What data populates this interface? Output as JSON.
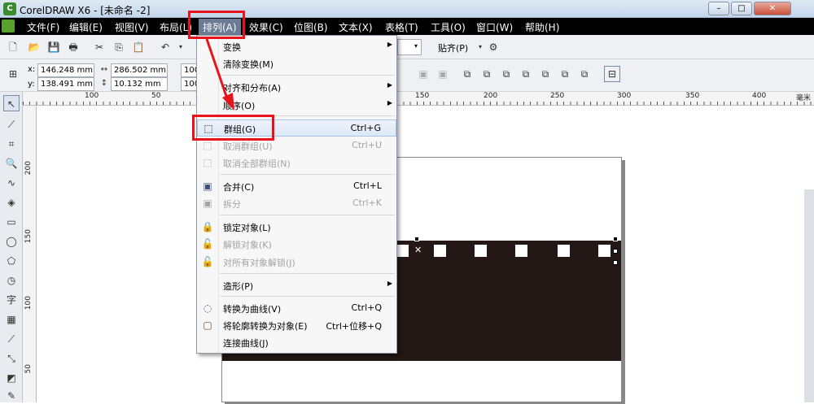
{
  "window": {
    "title": "CorelDRAW X6 - [未命名 -2]"
  },
  "menubar": {
    "items": [
      "文件(F)",
      "编辑(E)",
      "视图(V)",
      "布局(L)",
      "排列(A)",
      "效果(C)",
      "位图(B)",
      "文本(X)",
      "表格(T)",
      "工具(O)",
      "窗口(W)",
      "帮助(H)"
    ],
    "active": "排列(A)"
  },
  "toolbar": {
    "snap_label": "贴齐(P)",
    "zoom_partial": "100"
  },
  "property_bar": {
    "x_label": "x:",
    "x_value": "146.248 mm",
    "y_label": "y:",
    "y_value": "138.491 mm",
    "w_value": "286.502 mm",
    "h_value": "10.132 mm",
    "scale_1": "100",
    "scale_2": "100"
  },
  "ruler": {
    "h_ticks": [
      "100",
      "50",
      "150",
      "200",
      "250",
      "300",
      "350",
      "400"
    ],
    "h_unit": "毫米",
    "v_ticks": [
      "200",
      "150",
      "100",
      "50"
    ]
  },
  "arrange_menu": {
    "items": [
      {
        "label": "变换",
        "shortcut": "",
        "submenu": true,
        "disabled": false,
        "icon": ""
      },
      {
        "label": "清除变换(M)",
        "shortcut": "",
        "submenu": false,
        "disabled": false,
        "icon": ""
      },
      {
        "label": "对齐和分布(A)",
        "shortcut": "",
        "submenu": true,
        "disabled": false,
        "icon": ""
      },
      {
        "label": "顺序(O)",
        "shortcut": "",
        "submenu": true,
        "disabled": false,
        "icon": ""
      },
      {
        "label": "群组(G)",
        "shortcut": "Ctrl+G",
        "submenu": false,
        "disabled": false,
        "icon": "group-icon"
      },
      {
        "label": "取消群组(U)",
        "shortcut": "Ctrl+U",
        "submenu": false,
        "disabled": true,
        "icon": "ungroup-icon"
      },
      {
        "label": "取消全部群组(N)",
        "shortcut": "",
        "submenu": false,
        "disabled": true,
        "icon": "ungroup-all-icon"
      },
      {
        "label": "合并(C)",
        "shortcut": "Ctrl+L",
        "submenu": false,
        "disabled": false,
        "icon": "combine-icon"
      },
      {
        "label": "拆分",
        "shortcut": "Ctrl+K",
        "submenu": false,
        "disabled": true,
        "icon": "break-apart-icon"
      },
      {
        "label": "锁定对象(L)",
        "shortcut": "",
        "submenu": false,
        "disabled": false,
        "icon": "lock-icon"
      },
      {
        "label": "解锁对象(K)",
        "shortcut": "",
        "submenu": false,
        "disabled": true,
        "icon": "unlock-icon"
      },
      {
        "label": "对所有对象解锁(J)",
        "shortcut": "",
        "submenu": false,
        "disabled": true,
        "icon": "unlock-all-icon"
      },
      {
        "label": "造形(P)",
        "shortcut": "",
        "submenu": true,
        "disabled": false,
        "icon": ""
      },
      {
        "label": "转换为曲线(V)",
        "shortcut": "Ctrl+Q",
        "submenu": false,
        "disabled": false,
        "icon": "convert-curves-icon"
      },
      {
        "label": "将轮廓转换为对象(E)",
        "shortcut": "Ctrl+位移+Q",
        "submenu": false,
        "disabled": false,
        "icon": "outline-to-object-icon"
      },
      {
        "label": "连接曲线(J)",
        "shortcut": "",
        "submenu": false,
        "disabled": false,
        "icon": ""
      }
    ],
    "highlighted": "群组(G)"
  },
  "colors": {
    "accent_red": "#e8141c",
    "menubar": "#000000",
    "rect_fill": "#231815"
  }
}
